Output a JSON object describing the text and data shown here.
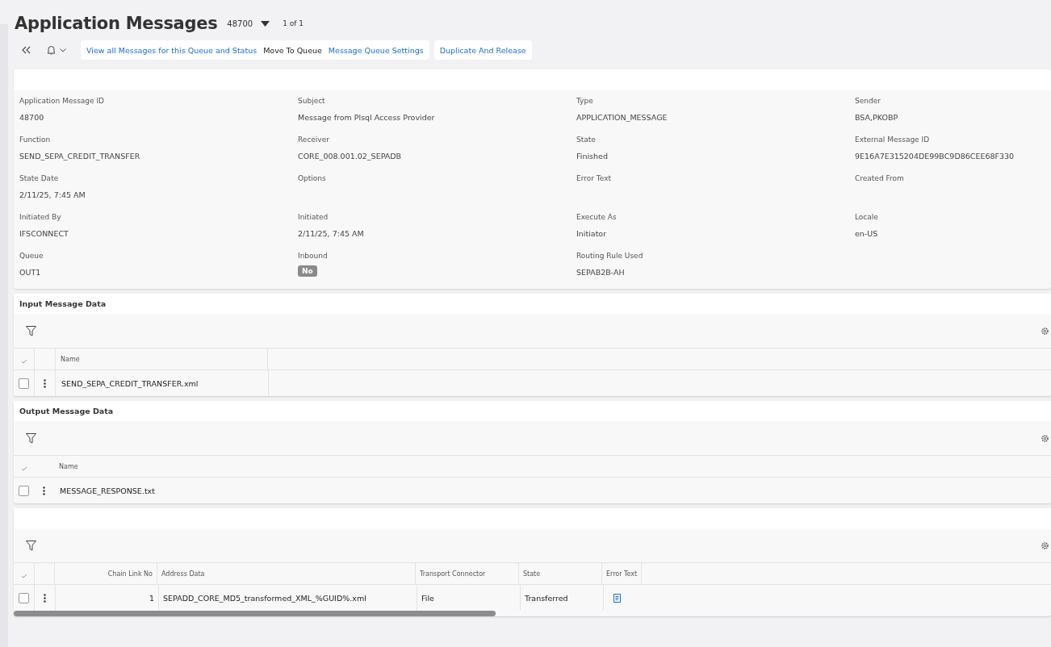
{
  "page": {
    "title": "Application Messages",
    "record": "48700",
    "pager": "1 of 1"
  },
  "toolbar_groups": [
    [
      {
        "label": "View all Messages for this Queue and Status",
        "kind": "link"
      },
      {
        "label": "Move To Queue",
        "kind": "text"
      },
      {
        "label": "Message Queue Settings",
        "kind": "link"
      }
    ],
    [
      {
        "label": "Duplicate And Release",
        "kind": "link"
      }
    ]
  ],
  "fields": [
    {
      "label": "Application Message ID",
      "value": "48700"
    },
    {
      "label": "Subject",
      "value": "Message from Plsql Access Provider"
    },
    {
      "label": "Type",
      "value": "APPLICATION_MESSAGE"
    },
    {
      "label": "Sender",
      "value": "BSA,PKOBP"
    },
    {
      "label": "Function",
      "value": "SEND_SEPA_CREDIT_TRANSFER"
    },
    {
      "label": "Receiver",
      "value": "CORE_008.001.02_SEPADB"
    },
    {
      "label": "State",
      "value": "Finished"
    },
    {
      "label": "External Message ID",
      "value": "9E16A7E315204DE99BC9D86CEE68F330"
    },
    {
      "label": "State Date",
      "value": "2/11/25, 7:45 AM"
    },
    {
      "label": "Options"
    },
    {
      "label": "Error Text"
    },
    {
      "label": "Created From"
    },
    {
      "label": "Initiated By",
      "value": "IFSCONNECT"
    },
    {
      "label": "Initiated",
      "value": "2/11/25, 7:45 AM"
    },
    {
      "label": "Execute As",
      "value": "Initiator"
    },
    {
      "label": "Locale",
      "value": "en-US"
    },
    {
      "label": "Queue",
      "value": "OUT1"
    },
    {
      "label": "Inbound",
      "value": "No",
      "kind": "badge"
    },
    {
      "label": "Routing Rule Used",
      "value": "SEPAB2B-AH"
    }
  ],
  "input_message_data": {
    "title": "Input Message Data",
    "columns": [
      "Name"
    ],
    "rows": [
      {
        "checked": false,
        "cells": [
          "SEND_SEPA_CREDIT_TRANSFER.xml"
        ]
      }
    ]
  },
  "output_message_data": {
    "title": "Output Message Data",
    "columns": [
      "Name"
    ],
    "rows": [
      {
        "checked": false,
        "cells": [
          "MESSAGE_RESPONSE.txt"
        ]
      }
    ]
  },
  "addresses": {
    "columns": [
      "Chain Link No",
      "Address Data",
      "Transport Connector",
      "State",
      "Error Text"
    ],
    "rows": [
      {
        "checked": false,
        "cells": [
          "1",
          "SEPADD_CORE_MD5_transformed_XML_%GUID%.xml",
          "File",
          "Transferred"
        ]
      }
    ]
  }
}
